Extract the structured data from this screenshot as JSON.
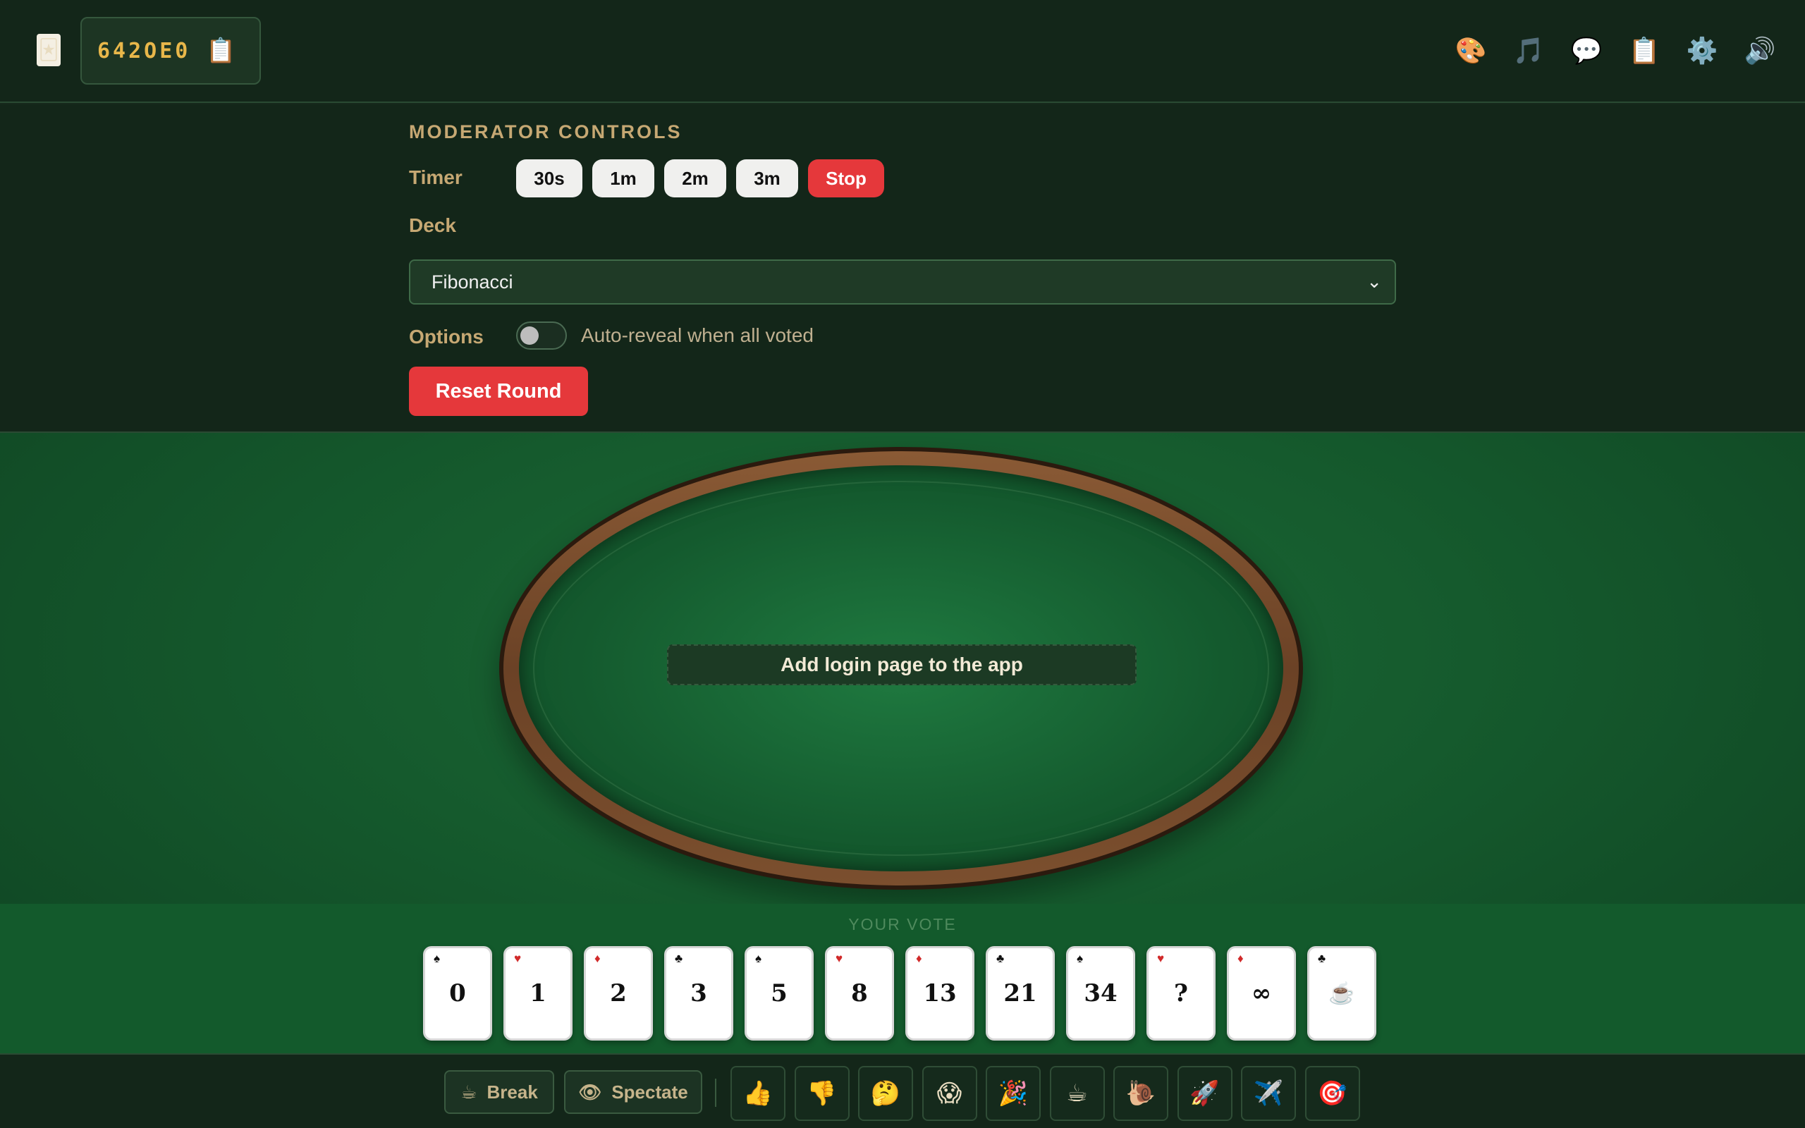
{
  "header": {
    "logo_icon": "🃏",
    "room_code": "642OE0",
    "copy_icon": "📋",
    "icons": [
      {
        "name": "palette-icon",
        "glyph": "🎨"
      },
      {
        "name": "music-icon",
        "glyph": "🎵"
      },
      {
        "name": "chat-icon",
        "glyph": "💬"
      },
      {
        "name": "clipboard-icon",
        "glyph": "📋"
      },
      {
        "name": "settings-icon",
        "glyph": "⚙️"
      },
      {
        "name": "sound-icon",
        "glyph": "🔊"
      }
    ]
  },
  "moderator": {
    "title": "MODERATOR CONTROLS",
    "timer_label": "Timer",
    "timer_buttons": [
      "30s",
      "1m",
      "2m",
      "3m"
    ],
    "stop_label": "Stop",
    "deck_label": "Deck",
    "deck_selected": "Fibonacci",
    "options_label": "Options",
    "auto_reveal_label": "Auto-reveal when all voted",
    "auto_reveal_on": false,
    "reset_label": "Reset Round"
  },
  "table": {
    "story_title": "Add login page to the app"
  },
  "vote": {
    "label": "YOUR VOTE",
    "cards": [
      {
        "value": "0",
        "suit": "♠",
        "color": "black"
      },
      {
        "value": "1",
        "suit": "♥",
        "color": "red"
      },
      {
        "value": "2",
        "suit": "♦",
        "color": "red"
      },
      {
        "value": "3",
        "suit": "♣",
        "color": "black"
      },
      {
        "value": "5",
        "suit": "♠",
        "color": "black"
      },
      {
        "value": "8",
        "suit": "♥",
        "color": "red"
      },
      {
        "value": "13",
        "suit": "♦",
        "color": "red"
      },
      {
        "value": "21",
        "suit": "♣",
        "color": "black"
      },
      {
        "value": "34",
        "suit": "♠",
        "color": "black"
      },
      {
        "value": "?",
        "suit": "♥",
        "color": "red"
      },
      {
        "value": "∞",
        "suit": "♦",
        "color": "red"
      },
      {
        "value": "☕",
        "suit": "♣",
        "color": "black"
      }
    ]
  },
  "bottom": {
    "break_icon": "☕",
    "break_label": "Break",
    "spectate_icon": "👁",
    "spectate_label": "Spectate",
    "reactions": [
      {
        "name": "thumbs-up-icon",
        "glyph": "👍"
      },
      {
        "name": "thumbs-down-icon",
        "glyph": "👎"
      },
      {
        "name": "thinking-icon",
        "glyph": "🤔"
      },
      {
        "name": "shocked-icon",
        "glyph": "😱"
      },
      {
        "name": "party-icon",
        "glyph": "🎉"
      },
      {
        "name": "coffee-icon",
        "glyph": "☕"
      },
      {
        "name": "snail-icon",
        "glyph": "🐌"
      },
      {
        "name": "rocket-icon",
        "glyph": "🚀"
      },
      {
        "name": "airplane-icon",
        "glyph": "✈️"
      },
      {
        "name": "target-icon",
        "glyph": "🎯"
      }
    ]
  }
}
